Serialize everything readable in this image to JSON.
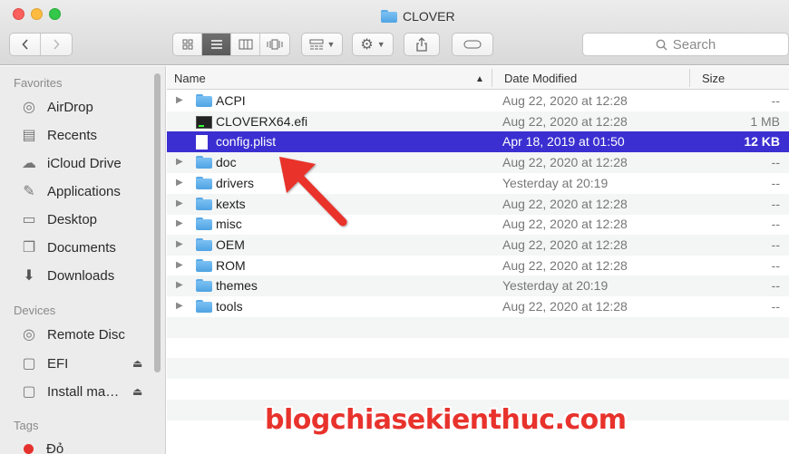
{
  "window": {
    "title": "CLOVER"
  },
  "toolbar": {
    "back_icon": "chevron-left",
    "forward_icon": "chevron-right",
    "view_icons": [
      "icon-view",
      "list-view",
      "column-view",
      "cover-flow-view"
    ],
    "active_view": "list-view",
    "search_placeholder": "Search"
  },
  "sidebar": {
    "favorites_header": "Favorites",
    "favorites": [
      {
        "label": "AirDrop",
        "icon": "airdrop-icon"
      },
      {
        "label": "Recents",
        "icon": "recents-icon"
      },
      {
        "label": "iCloud Drive",
        "icon": "cloud-icon"
      },
      {
        "label": "Applications",
        "icon": "applications-icon"
      },
      {
        "label": "Desktop",
        "icon": "desktop-icon"
      },
      {
        "label": "Documents",
        "icon": "documents-icon"
      },
      {
        "label": "Downloads",
        "icon": "downloads-icon"
      }
    ],
    "devices_header": "Devices",
    "devices": [
      {
        "label": "Remote Disc",
        "icon": "disc-icon"
      },
      {
        "label": "EFI",
        "icon": "drive-icon"
      },
      {
        "label": "Install ma…",
        "icon": "drive-icon"
      }
    ],
    "tags_header": "Tags",
    "tags": [
      {
        "label": "Đỏ",
        "color": "#e5312c"
      }
    ]
  },
  "columns": {
    "name": "Name",
    "date": "Date Modified",
    "size": "Size",
    "sort_indicator": "^"
  },
  "files": [
    {
      "name": "ACPI",
      "type": "folder",
      "date": "Aug 22, 2020 at 12:28",
      "size": "--"
    },
    {
      "name": "CLOVERX64.efi",
      "type": "exec",
      "date": "Aug 22, 2020 at 12:28",
      "size": "1 MB"
    },
    {
      "name": "config.plist",
      "type": "file",
      "date": "Apr 18, 2019 at 01:50",
      "size": "12 KB",
      "selected": true
    },
    {
      "name": "doc",
      "type": "folder",
      "date": "Aug 22, 2020 at 12:28",
      "size": "--"
    },
    {
      "name": "drivers",
      "type": "folder",
      "date": "Yesterday at 20:19",
      "size": "--"
    },
    {
      "name": "kexts",
      "type": "folder",
      "date": "Aug 22, 2020 at 12:28",
      "size": "--"
    },
    {
      "name": "misc",
      "type": "folder",
      "date": "Aug 22, 2020 at 12:28",
      "size": "--"
    },
    {
      "name": "OEM",
      "type": "folder",
      "date": "Aug 22, 2020 at 12:28",
      "size": "--"
    },
    {
      "name": "ROM",
      "type": "folder",
      "date": "Aug 22, 2020 at 12:28",
      "size": "--"
    },
    {
      "name": "themes",
      "type": "folder",
      "date": "Yesterday at 20:19",
      "size": "--"
    },
    {
      "name": "tools",
      "type": "folder",
      "date": "Aug 22, 2020 at 12:28",
      "size": "--"
    }
  ],
  "watermark": "blogchiasekienthuc.com",
  "colors": {
    "selection": "#3b2fd1",
    "arrow": "#e8322c",
    "folder": "#5aa9e6"
  }
}
